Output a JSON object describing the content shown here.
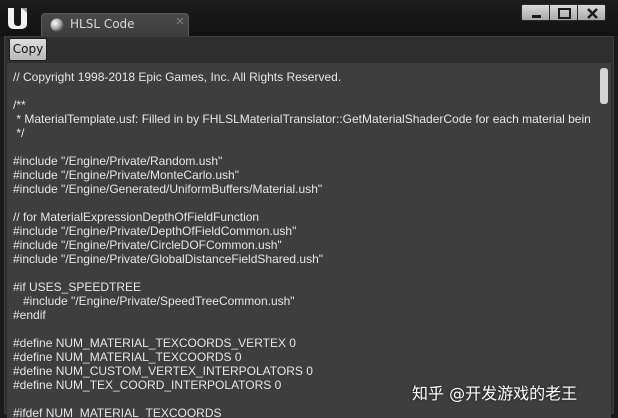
{
  "window": {
    "tab_title": "HLSL Code",
    "tab_icon": "material-sphere-icon",
    "controls": [
      "minimize-icon",
      "maximize-icon",
      "close-icon"
    ]
  },
  "toolbar": {
    "copy_label": "Copy"
  },
  "code": {
    "lines": [
      "// Copyright 1998-2018 Epic Games, Inc. All Rights Reserved.",
      "",
      "/**",
      " * MaterialTemplate.usf: Filled in by FHLSLMaterialTranslator::GetMaterialShaderCode for each material bein",
      " */",
      "",
      "#include \"/Engine/Private/Random.ush\"",
      "#include \"/Engine/Private/MonteCarlo.ush\"",
      "#include \"/Engine/Generated/UniformBuffers/Material.ush\"",
      "",
      "// for MaterialExpressionDepthOfFieldFunction",
      "#include \"/Engine/Private/DepthOfFieldCommon.ush\"",
      "#include \"/Engine/Private/CircleDOFCommon.ush\"",
      "#include \"/Engine/Private/GlobalDistanceFieldShared.ush\"",
      "",
      "#if USES_SPEEDTREE",
      "   #include \"/Engine/Private/SpeedTreeCommon.ush\"",
      "#endif",
      "",
      "#define NUM_MATERIAL_TEXCOORDS_VERTEX 0",
      "#define NUM_MATERIAL_TEXCOORDS 0",
      "#define NUM_CUSTOM_VERTEX_INTERPOLATORS 0",
      "#define NUM_TEX_COORD_INTERPOLATORS 0",
      "",
      "#ifdef NUM_MATERIAL_TEXCOORDS"
    ]
  },
  "watermark": "知乎 @开发游戏的老王",
  "colors": {
    "editor_bg": "#3e3e3e",
    "code_text": "#e6e6e6",
    "titlebar_bg": "#151515"
  }
}
